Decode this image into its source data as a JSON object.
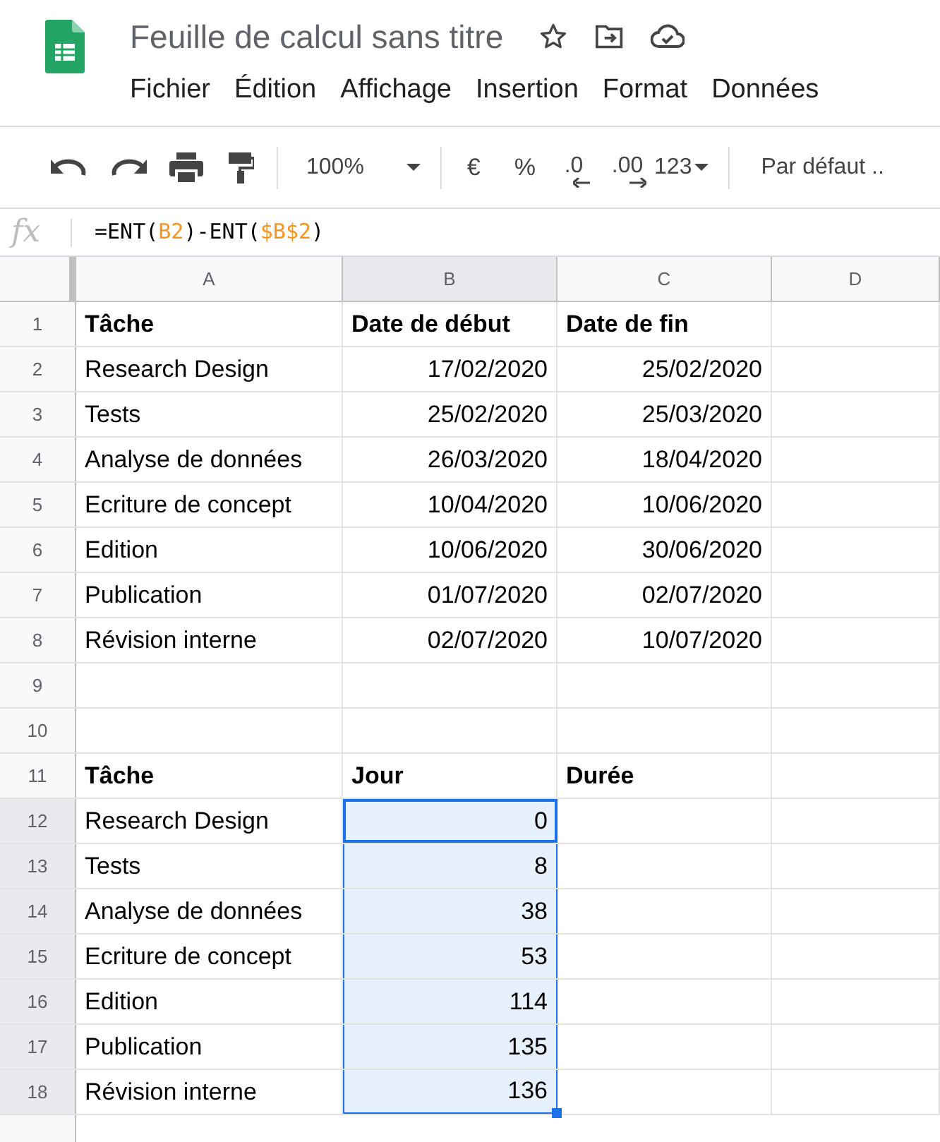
{
  "document": {
    "title": "Feuille de calcul sans titre"
  },
  "menu": [
    "Fichier",
    "Édition",
    "Affichage",
    "Insertion",
    "Format",
    "Données"
  ],
  "toolbar": {
    "zoom": "100%",
    "currency": "€",
    "percent": "%",
    "decrease_decimals": ".0",
    "increase_decimals": ".00",
    "number_format": "123",
    "font": "Par défaut .."
  },
  "formula_bar": {
    "label": "fx",
    "tokens": [
      {
        "text": "=ENT(",
        "kind": "plain"
      },
      {
        "text": "B2",
        "kind": "ref"
      },
      {
        "text": ")-ENT(",
        "kind": "plain"
      },
      {
        "text": "$B$2",
        "kind": "ref"
      },
      {
        "text": ")",
        "kind": "plain"
      }
    ]
  },
  "columns": [
    {
      "label": "A",
      "selected": false
    },
    {
      "label": "B",
      "selected": true
    },
    {
      "label": "C",
      "selected": false
    },
    {
      "label": "D",
      "selected": false
    }
  ],
  "rows": [
    {
      "number": "1",
      "kind": "header",
      "selected": false,
      "active": false,
      "cells": [
        "Tâche",
        "Date de début",
        "Date de fin"
      ]
    },
    {
      "number": "2",
      "kind": "data",
      "selected": false,
      "active": false,
      "cells": [
        "Research Design",
        "17/02/2020",
        "25/02/2020"
      ]
    },
    {
      "number": "3",
      "kind": "data",
      "selected": false,
      "active": false,
      "cells": [
        "Tests",
        "25/02/2020",
        "25/03/2020"
      ]
    },
    {
      "number": "4",
      "kind": "data",
      "selected": false,
      "active": false,
      "cells": [
        "Analyse de données",
        "26/03/2020",
        "18/04/2020"
      ]
    },
    {
      "number": "5",
      "kind": "data",
      "selected": false,
      "active": false,
      "cells": [
        "Ecriture de concept",
        "10/04/2020",
        "10/06/2020"
      ]
    },
    {
      "number": "6",
      "kind": "data",
      "selected": false,
      "active": false,
      "cells": [
        "Edition",
        "10/06/2020",
        "30/06/2020"
      ]
    },
    {
      "number": "7",
      "kind": "data",
      "selected": false,
      "active": false,
      "cells": [
        "Publication",
        "01/07/2020",
        "02/07/2020"
      ]
    },
    {
      "number": "8",
      "kind": "data",
      "selected": false,
      "active": false,
      "cells": [
        "Révision interne",
        "02/07/2020",
        "10/07/2020"
      ]
    },
    {
      "number": "9",
      "kind": "data",
      "selected": false,
      "active": false,
      "cells": []
    },
    {
      "number": "10",
      "kind": "data",
      "selected": false,
      "active": false,
      "cells": []
    },
    {
      "number": "11",
      "kind": "header",
      "selected": false,
      "active": false,
      "cells": [
        "Tâche",
        "Jour",
        "Durée"
      ]
    },
    {
      "number": "12",
      "kind": "data",
      "selected": true,
      "active": true,
      "cells": [
        "Research Design",
        "0"
      ]
    },
    {
      "number": "13",
      "kind": "data",
      "selected": true,
      "active": false,
      "cells": [
        "Tests",
        "8"
      ]
    },
    {
      "number": "14",
      "kind": "data",
      "selected": true,
      "active": false,
      "cells": [
        "Analyse de données",
        "38"
      ]
    },
    {
      "number": "15",
      "kind": "data",
      "selected": true,
      "active": false,
      "cells": [
        "Ecriture de concept",
        "53"
      ]
    },
    {
      "number": "16",
      "kind": "data",
      "selected": true,
      "active": false,
      "cells": [
        "Edition",
        "114"
      ]
    },
    {
      "number": "17",
      "kind": "data",
      "selected": true,
      "active": false,
      "cells": [
        "Publication",
        "135"
      ]
    },
    {
      "number": "18",
      "kind": "data",
      "selected": true,
      "active": false,
      "cells": [
        "Révision interne",
        "136"
      ]
    }
  ]
}
